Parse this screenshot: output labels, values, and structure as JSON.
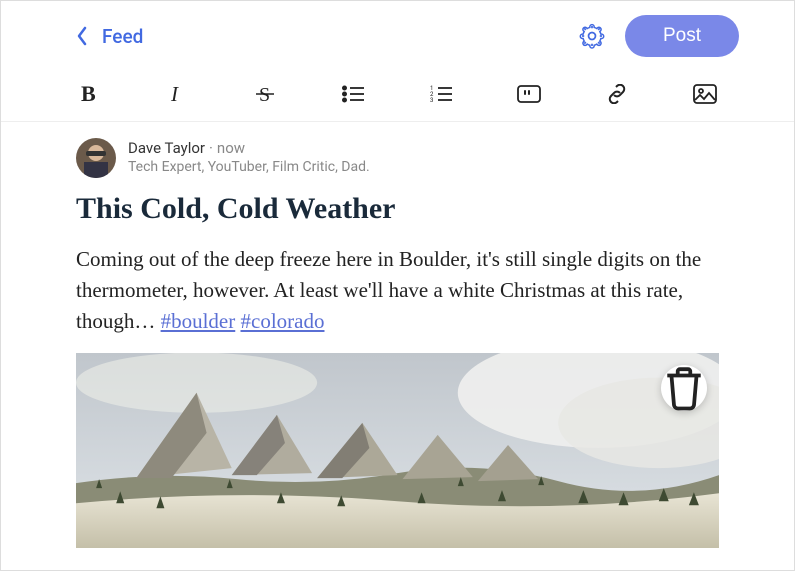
{
  "header": {
    "back_label": "Feed",
    "post_button": "Post"
  },
  "toolbar": {
    "bold": "B",
    "italic": "I",
    "strike": "S",
    "bullets": "bulleted-list",
    "numbers": "numbered-list",
    "quote": "quote",
    "link": "link",
    "image": "image"
  },
  "author": {
    "name": "Dave Taylor",
    "timestamp": "now",
    "tagline": "Tech Expert, YouTuber, Film Critic, Dad."
  },
  "post": {
    "title": "This Cold, Cold Weather",
    "body": "Coming out of the deep freeze here in Boulder, it's still single digits on the thermometer, however. At least we'll have a white Christmas at this rate, though… ",
    "hashtag1": "#boulder",
    "hashtag2": "#colorado"
  }
}
